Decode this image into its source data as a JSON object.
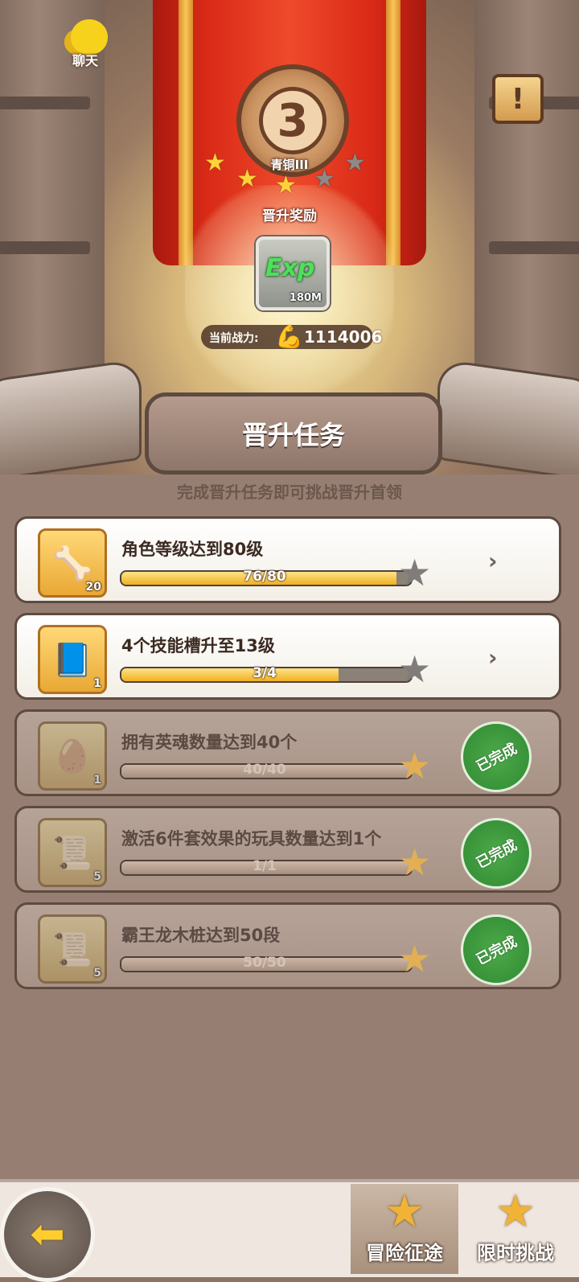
{
  "top": {
    "chat_label": "聊天",
    "rank_number": "3",
    "rank_name": "青铜III",
    "rank_stars": [
      true,
      true,
      true,
      false,
      false
    ],
    "reward_title": "晋升奖励",
    "reward": {
      "icon": "Exp",
      "amount": "180M"
    },
    "power_label": "当前战力:",
    "power_value": "1114006"
  },
  "section": {
    "title": "晋升任务",
    "hint": "完成晋升任务即可挑战晋升首领"
  },
  "tasks": [
    {
      "title": "角色等级达到80级",
      "progress": "76/80",
      "ratio": 0.95,
      "count": "20",
      "state": "active",
      "icon": "fossil-icon"
    },
    {
      "title": "4个技能槽升至13级",
      "progress": "3/4",
      "ratio": 0.75,
      "count": "1",
      "state": "active",
      "icon": "skill-scroll-icon"
    },
    {
      "title": "拥有英魂数量达到40个",
      "progress": "40/40",
      "ratio": 1.0,
      "count": "1",
      "state": "done",
      "icon": "egg-icon"
    },
    {
      "title": "激活6件套效果的玩具数量达到1个",
      "progress": "1/1",
      "ratio": 1.0,
      "count": "5",
      "state": "done",
      "icon": "blueprint-icon"
    },
    {
      "title": "霸王龙木桩达到50段",
      "progress": "50/50",
      "ratio": 1.0,
      "count": "5",
      "state": "done",
      "icon": "blueprint-icon"
    }
  ],
  "done_label": "已完成",
  "bottom": {
    "adventure": "冒险征途",
    "limited": "限时挑战"
  }
}
